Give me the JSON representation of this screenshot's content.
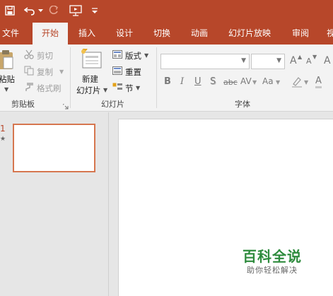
{
  "quick_access": {
    "save_icon": "save-icon",
    "undo_icon": "undo-icon",
    "redo_icon": "redo-icon",
    "start_from_beginning_icon": "slideshow-from-start-icon",
    "customize_icon": "customize-qat-icon"
  },
  "tabs": [
    {
      "label": "文件",
      "active": false
    },
    {
      "label": "开始",
      "active": true
    },
    {
      "label": "插入",
      "active": false
    },
    {
      "label": "设计",
      "active": false
    },
    {
      "label": "切换",
      "active": false
    },
    {
      "label": "动画",
      "active": false
    },
    {
      "label": "幻灯片放映",
      "active": false
    },
    {
      "label": "审阅",
      "active": false
    },
    {
      "label": "视",
      "active": false
    }
  ],
  "clipboard": {
    "paste_label": "粘贴",
    "cut_label": "剪切",
    "copy_label": "复制",
    "format_painter_label": "格式刷",
    "group_label": "剪贴板"
  },
  "slides_group": {
    "new_slide_line1": "新建",
    "new_slide_line2": "幻灯片",
    "layout_label": "版式",
    "reset_label": "重置",
    "section_label": "节",
    "group_label": "幻灯片"
  },
  "font_group": {
    "font_name_value": "",
    "font_size_value": "",
    "bold": "B",
    "italic": "I",
    "underline": "U",
    "shadow": "S",
    "strikethrough": "abc",
    "char_spacing": "AV",
    "change_case": "Aa",
    "grow_font": "A",
    "shrink_font": "A",
    "clear_format": "A",
    "group_label": "字体"
  },
  "thumbnails": [
    {
      "number": "1",
      "star": "★"
    }
  ],
  "watermark": {
    "title": "百科全说",
    "subtitle": "助你轻松解决"
  },
  "colors": {
    "accent": "#b7472a",
    "ribbon_bg": "#f3f3f3",
    "workspace_bg": "#e6e6e6",
    "thumb_border": "#d6764f",
    "watermark_green": "#2e8b3d"
  }
}
